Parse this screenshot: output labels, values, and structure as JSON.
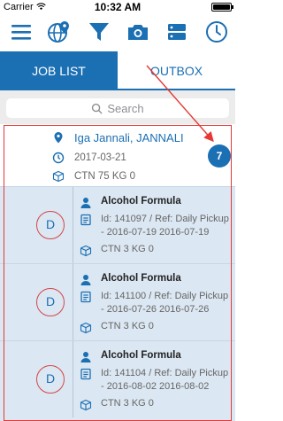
{
  "status_bar": {
    "carrier": "Carrier",
    "time": "10:32 AM"
  },
  "toolbar": {
    "icons": [
      "menu-icon",
      "globe-pin-icon",
      "filter-icon",
      "camera-icon",
      "server-icon",
      "clock-icon"
    ]
  },
  "tabs": [
    {
      "label": "JOB LIST",
      "active": true
    },
    {
      "label": "OUTBOX",
      "active": false
    }
  ],
  "search": {
    "placeholder": "Search"
  },
  "location_header": {
    "name": "Iga Jannali, JANNALI",
    "date": "2017-03-21",
    "summary": "CTN 75 KG 0",
    "count": "7"
  },
  "jobs": [
    {
      "badge": "D",
      "title": "Alcohol Formula",
      "ref": "Id: 141097 / Ref: Daily Pickup - 2016-07-19 2016-07-19",
      "ctn": "CTN 3 KG 0"
    },
    {
      "badge": "D",
      "title": "Alcohol Formula",
      "ref": "Id: 141100 / Ref: Daily Pickup - 2016-07-26 2016-07-26",
      "ctn": "CTN 3 KG 0"
    },
    {
      "badge": "D",
      "title": "Alcohol Formula",
      "ref": "Id: 141104 / Ref: Daily Pickup - 2016-08-02 2016-08-02",
      "ctn": "CTN 3 KG 0"
    }
  ],
  "colors": {
    "accent": "#1b6fb3",
    "annotation": "#e53935",
    "job_bg": "#dbe7f2"
  }
}
